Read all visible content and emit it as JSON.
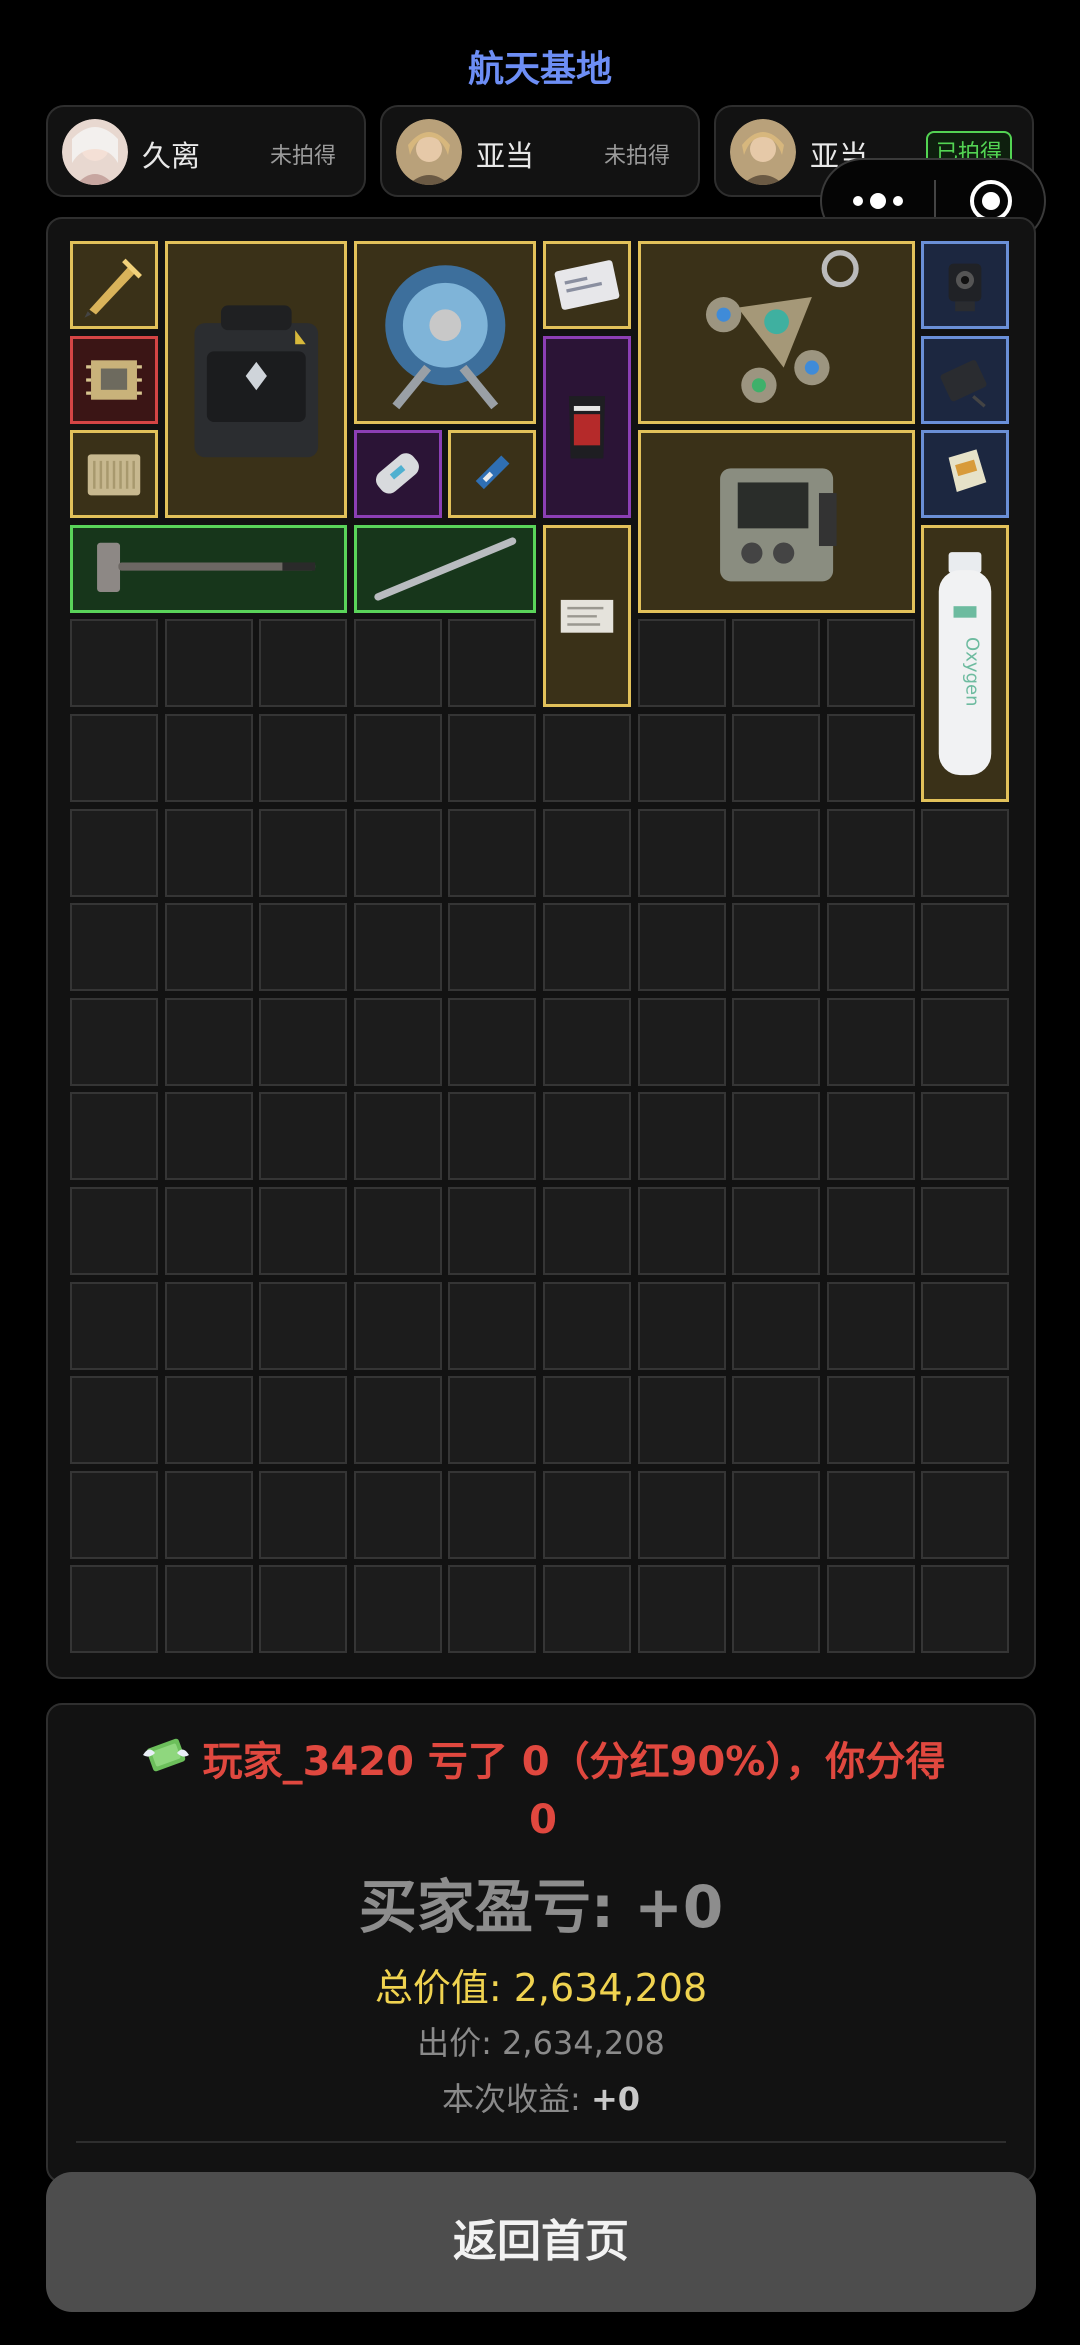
{
  "title": "航天基地",
  "players": [
    {
      "name": "久离",
      "status": "未拍得",
      "won": false
    },
    {
      "name": "亚当",
      "status": "未拍得",
      "won": false
    },
    {
      "name": "亚当",
      "status": "已拍得",
      "won": true
    }
  ],
  "items": [
    {
      "name": "gold-pen-icon",
      "quality": "gold"
    },
    {
      "name": "backpack-icon",
      "quality": "gold"
    },
    {
      "name": "cable-reel-icon",
      "quality": "gold"
    },
    {
      "name": "id-card-icon",
      "quality": "gold"
    },
    {
      "name": "keychain-icon",
      "quality": "gold"
    },
    {
      "name": "camera-icon",
      "quality": "blue"
    },
    {
      "name": "circuit-board-icon",
      "quality": "red"
    },
    {
      "name": "snack-bag-icon",
      "quality": "purple"
    },
    {
      "name": "hard-drive-icon",
      "quality": "blue"
    },
    {
      "name": "router-icon",
      "quality": "gold"
    },
    {
      "name": "battery-icon",
      "quality": "purple"
    },
    {
      "name": "ssd-icon",
      "quality": "gold"
    },
    {
      "name": "radio-station-icon",
      "quality": "gold"
    },
    {
      "name": "sd-card-icon",
      "quality": "blue"
    },
    {
      "name": "sledgehammer-icon",
      "quality": "green"
    },
    {
      "name": "metal-rod-icon",
      "quality": "green"
    },
    {
      "name": "document-icon",
      "quality": "gold"
    },
    {
      "name": "oxygen-tank-icon",
      "quality": "gold",
      "label": "Oxygen"
    }
  ],
  "result": {
    "message_line1": "玩家_3420 亏了 0（分红90%），你分得",
    "message_line2": "0",
    "buyer_profit": "买家盈亏: +0",
    "total_value": "总价值: 2,634,208",
    "bid": "出价: 2,634,208",
    "gain_label": "本次收益: ",
    "gain_value": "+0"
  },
  "home_button": "返回首页",
  "colors": {
    "title": "#6d8ef5",
    "loss_text": "#e0483f",
    "total_value": "#f0d350",
    "won_badge": "#53d453"
  }
}
